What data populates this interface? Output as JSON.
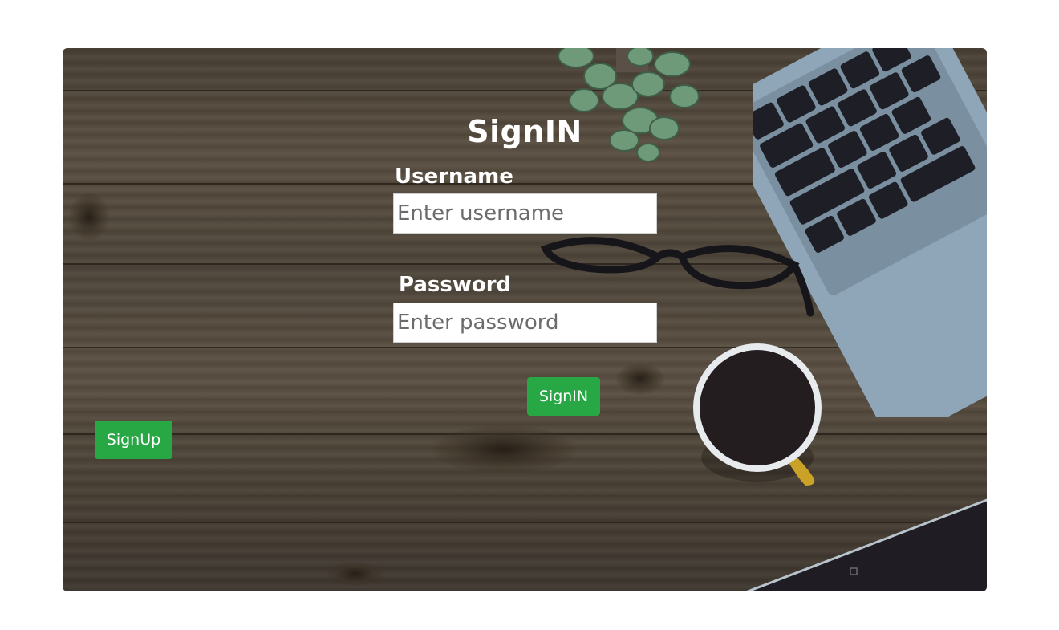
{
  "form": {
    "title": "SignIN",
    "username_label": "Username",
    "username_placeholder": "Enter username",
    "password_label": "Password",
    "password_placeholder": "Enter password",
    "signin_button": "SignIN",
    "signup_button": "SignUp"
  },
  "colors": {
    "button_green": "#28a745",
    "text_white": "#ffffff"
  }
}
